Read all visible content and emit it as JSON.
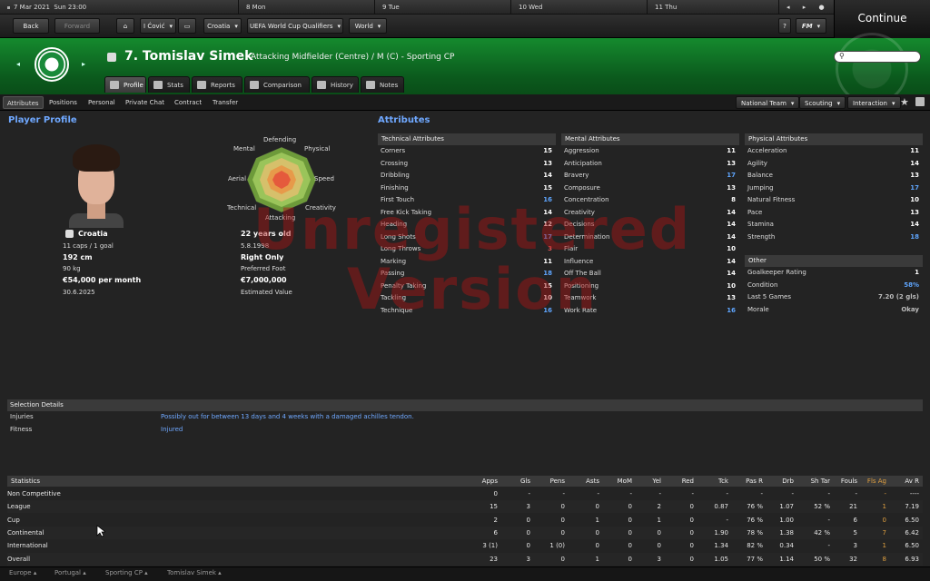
{
  "topbar": {
    "date": "7 Mar 2021",
    "time": "Sun 23:00",
    "cal": [
      "8 Mon",
      "9 Tue",
      "10 Wed",
      "11 Thu"
    ],
    "back": "Back",
    "forward": "Forward",
    "manager": "I Ćović",
    "nation": "Croatia",
    "competition": "UEFA World Cup Qualifiers",
    "world": "World",
    "help": "?",
    "fm": "FM",
    "continue": "Continue"
  },
  "player": {
    "name": "7. Tomislav Simek",
    "position": "Attacking Midfielder (Centre) / M (C) - Sporting CP",
    "club_colors": {
      "primary": "#0b6a22",
      "accent": "#5fa6ff"
    }
  },
  "tabs": [
    {
      "label": "Profile",
      "icon": "profile-icon"
    },
    {
      "label": "Stats",
      "icon": "stats-icon"
    },
    {
      "label": "Reports",
      "icon": "reports-icon"
    },
    {
      "label": "Comparison",
      "icon": "comparison-icon"
    },
    {
      "label": "History",
      "icon": "history-icon"
    },
    {
      "label": "Notes",
      "icon": "notes-icon"
    }
  ],
  "subnav": [
    "Attributes",
    "Positions",
    "Personal",
    "Private Chat",
    "Contract",
    "Transfer"
  ],
  "actions": [
    "National Team",
    "Scouting",
    "Interaction"
  ],
  "profile": {
    "title": "Player Profile",
    "nation": "Croatia",
    "caps": "11 caps / 1 goal",
    "height": "192 cm",
    "weight": "90 kg",
    "wage": "€54,000 per month",
    "contract": "30.6.2025",
    "age": "22 years old",
    "dob": "5.8.1998",
    "foot": "Right Only",
    "foot_label": "Preferred Foot",
    "value": "€7,000,000",
    "value_label": "Estimated Value"
  },
  "radar": {
    "labels": [
      "Defending",
      "Physical",
      "Speed",
      "Creativity",
      "Attacking",
      "Technical",
      "Aerial",
      "Mental"
    ]
  },
  "attributes": {
    "title": "Attributes",
    "technical": {
      "title": "Technical Attributes",
      "rows": [
        [
          "Corners",
          "15"
        ],
        [
          "Crossing",
          "13"
        ],
        [
          "Dribbling",
          "14"
        ],
        [
          "Finishing",
          "15"
        ],
        [
          "First Touch",
          "16"
        ],
        [
          "Free Kick Taking",
          "14"
        ],
        [
          "Heading",
          "12"
        ],
        [
          "Long Shots",
          "17"
        ],
        [
          "Long Throws",
          "3"
        ],
        [
          "Marking",
          "11"
        ],
        [
          "Passing",
          "18"
        ],
        [
          "Penalty Taking",
          "15"
        ],
        [
          "Tackling",
          "10"
        ],
        [
          "Technique",
          "16"
        ]
      ]
    },
    "mental": {
      "title": "Mental Attributes",
      "rows": [
        [
          "Aggression",
          "11"
        ],
        [
          "Anticipation",
          "13"
        ],
        [
          "Bravery",
          "17"
        ],
        [
          "Composure",
          "13"
        ],
        [
          "Concentration",
          "8"
        ],
        [
          "Creativity",
          "14"
        ],
        [
          "Decisions",
          "14"
        ],
        [
          "Determination",
          "14"
        ],
        [
          "Flair",
          "10"
        ],
        [
          "Influence",
          "14"
        ],
        [
          "Off The Ball",
          "14"
        ],
        [
          "Positioning",
          "10"
        ],
        [
          "Teamwork",
          "13"
        ],
        [
          "Work Rate",
          "16"
        ]
      ]
    },
    "physical": {
      "title": "Physical Attributes",
      "rows": [
        [
          "Acceleration",
          "11"
        ],
        [
          "Agility",
          "14"
        ],
        [
          "Balance",
          "13"
        ],
        [
          "Jumping",
          "17"
        ],
        [
          "Natural Fitness",
          "10"
        ],
        [
          "Pace",
          "13"
        ],
        [
          "Stamina",
          "14"
        ],
        [
          "Strength",
          "18"
        ]
      ]
    },
    "other": {
      "title": "Other",
      "rows": [
        [
          "Goalkeeper Rating",
          "1"
        ],
        [
          "Condition",
          "58%"
        ],
        [
          "Last 5 Games",
          "7.20 (2 gls)"
        ],
        [
          "Morale",
          "Okay"
        ]
      ]
    }
  },
  "watermark": [
    "Unregistered",
    "Version"
  ],
  "selection": {
    "title": "Selection Details",
    "rows": [
      [
        "Injuries",
        "Possibly out for between 13 days and 4 weeks with a damaged achilles tendon."
      ],
      [
        "Fitness",
        "Injured"
      ]
    ]
  },
  "stats": {
    "headers": [
      "Statistics",
      "Apps",
      "Gls",
      "Pens",
      "Asts",
      "MoM",
      "Yel",
      "Red",
      "Tck",
      "Pas R",
      "Drb",
      "Sh Tar",
      "Fouls",
      "Fls Ag",
      "Av R"
    ],
    "rows": [
      [
        "Non Competitive",
        "0",
        "-",
        "-",
        "-",
        "-",
        "-",
        "-",
        "-",
        "-",
        "-",
        "-",
        "-",
        "-",
        "----"
      ],
      [
        "League",
        "15",
        "3",
        "0",
        "0",
        "0",
        "2",
        "0",
        "0.87",
        "76 %",
        "1.07",
        "52 %",
        "21",
        "1",
        "7.19"
      ],
      [
        "Cup",
        "2",
        "0",
        "0",
        "1",
        "0",
        "1",
        "0",
        "-",
        "76 %",
        "1.00",
        "-",
        "6",
        "0",
        "6.50"
      ],
      [
        "Continental",
        "6",
        "0",
        "0",
        "0",
        "0",
        "0",
        "0",
        "1.90",
        "78 %",
        "1.38",
        "42 %",
        "5",
        "7",
        "6.42"
      ],
      [
        "International",
        "3 (1)",
        "0",
        "1 (0)",
        "0",
        "0",
        "0",
        "0",
        "1.34",
        "82 %",
        "0.34",
        "-",
        "3",
        "1",
        "6.50"
      ],
      [
        "Overall",
        "23",
        "3",
        "0",
        "1",
        "0",
        "3",
        "0",
        "1.05",
        "77 %",
        "1.14",
        "50 %",
        "32",
        "8",
        "6.93"
      ]
    ]
  },
  "footer": [
    "Europe",
    "Portugal",
    "Sporting CP",
    "Tomislav Simek"
  ]
}
